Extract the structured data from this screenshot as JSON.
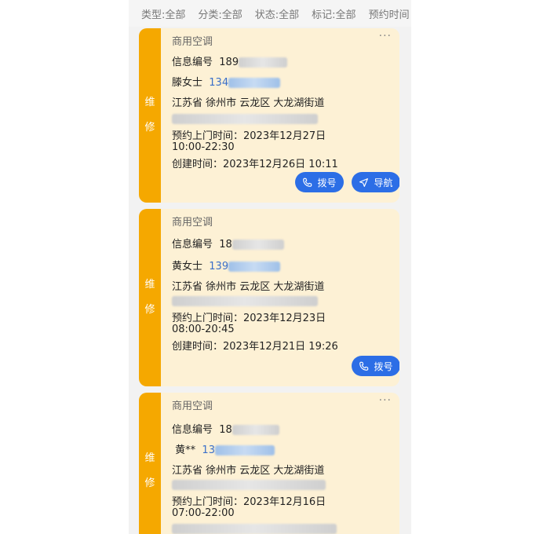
{
  "filters": [
    "类型:全部",
    "分类:全部",
    "状态:全部",
    "标记:全部",
    "预约时间"
  ],
  "cards": [
    {
      "tag": [
        "维",
        "修"
      ],
      "title": "商用空调",
      "more": "···",
      "info_label": "信息编号",
      "info_value": "189",
      "contact_name": "滕女士",
      "contact_phone": "134",
      "address": "江苏省 徐州市 云龙区 大龙湖街道",
      "appt_label": "预约上门时间：",
      "appt_date": "2023年12月27日",
      "appt_time": "10:00-22:30",
      "created": "创建时间：2023年12月26日 10:11",
      "btn_call": "拨号",
      "btn_nav": "导航"
    },
    {
      "tag": [
        "维",
        "修"
      ],
      "title": "商用空调",
      "info_label": "信息编号",
      "info_value": "18",
      "contact_name": "黄女士",
      "contact_phone": "139",
      "address": "江苏省 徐州市 云龙区 大龙湖街道",
      "appt_label": "预约上门时间：",
      "appt_date": "2023年12月23日",
      "appt_time": "08:00-20:45",
      "created": "创建时间：2023年12月21日 19:26",
      "btn_call": "拨号"
    },
    {
      "tag": [
        "维",
        "修"
      ],
      "title": "商用空调",
      "more": "···",
      "info_label": "信息编号",
      "info_value": "18",
      "contact_name": "黄**",
      "contact_phone": "13",
      "address": "江苏省 徐州市 云龙区 大龙湖街道",
      "appt_label": "预约上门时间：",
      "appt_date": "2023年12月16日",
      "appt_time": "07:00-22:00"
    }
  ],
  "colors": {
    "tag": "#f5a800",
    "card": "#fdf1d5",
    "button": "#2c6ee6",
    "link": "#3a6fc9"
  }
}
